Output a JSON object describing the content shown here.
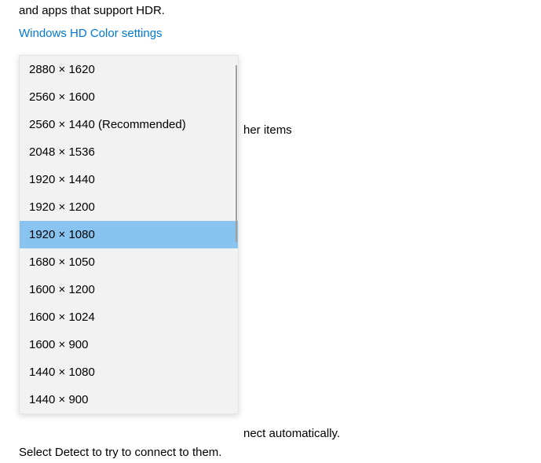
{
  "header": {
    "description": "and apps that support HDR.",
    "link": "Windows HD Color settings"
  },
  "backgroundText": {
    "scaleLabel": "her items"
  },
  "dropdown": {
    "items": [
      "2880 × 1620",
      "2560 × 1600",
      "2560 × 1440 (Recommended)",
      "2048 × 1536",
      "1920 × 1440",
      "1920 × 1200",
      "1920 × 1080",
      "1680 × 1050",
      "1600 × 1200",
      "1600 × 1024",
      "1600 × 900",
      "1440 × 1080",
      "1440 × 900"
    ],
    "selectedIndex": 6
  },
  "footer": {
    "line1suffix": "nect automatically.",
    "line2": "Select Detect to try to connect to them."
  }
}
